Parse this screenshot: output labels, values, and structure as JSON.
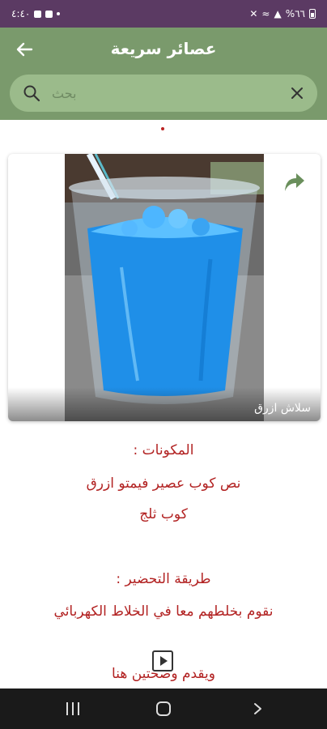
{
  "status_bar": {
    "time": "٤:٤٠",
    "battery": "%٦٦"
  },
  "header": {
    "title": "عصائر سريعة",
    "back_icon": "arrow-left-icon"
  },
  "search": {
    "placeholder": "بحث",
    "value": ""
  },
  "card": {
    "caption": "سلاش ازرق",
    "share_icon": "share-arrow-icon"
  },
  "recipe": {
    "ingredients_heading": "المكونات :",
    "ingredients": [
      "نص كوب عصير فيمتو ازرق",
      "كوب ثلج"
    ],
    "method_heading": "طريقة التحضير :",
    "method_text": "نقوم بخلطهم معا في الخلاط الكهربائي",
    "closing": "ويقدم وصحتين هنا"
  },
  "colors": {
    "status_bar": "#5b3a63",
    "app_bar": "#7a9a6c",
    "search_bg": "#9bbb8b",
    "recipe_text": "#b22222",
    "share_icon": "#6a8f5c"
  }
}
